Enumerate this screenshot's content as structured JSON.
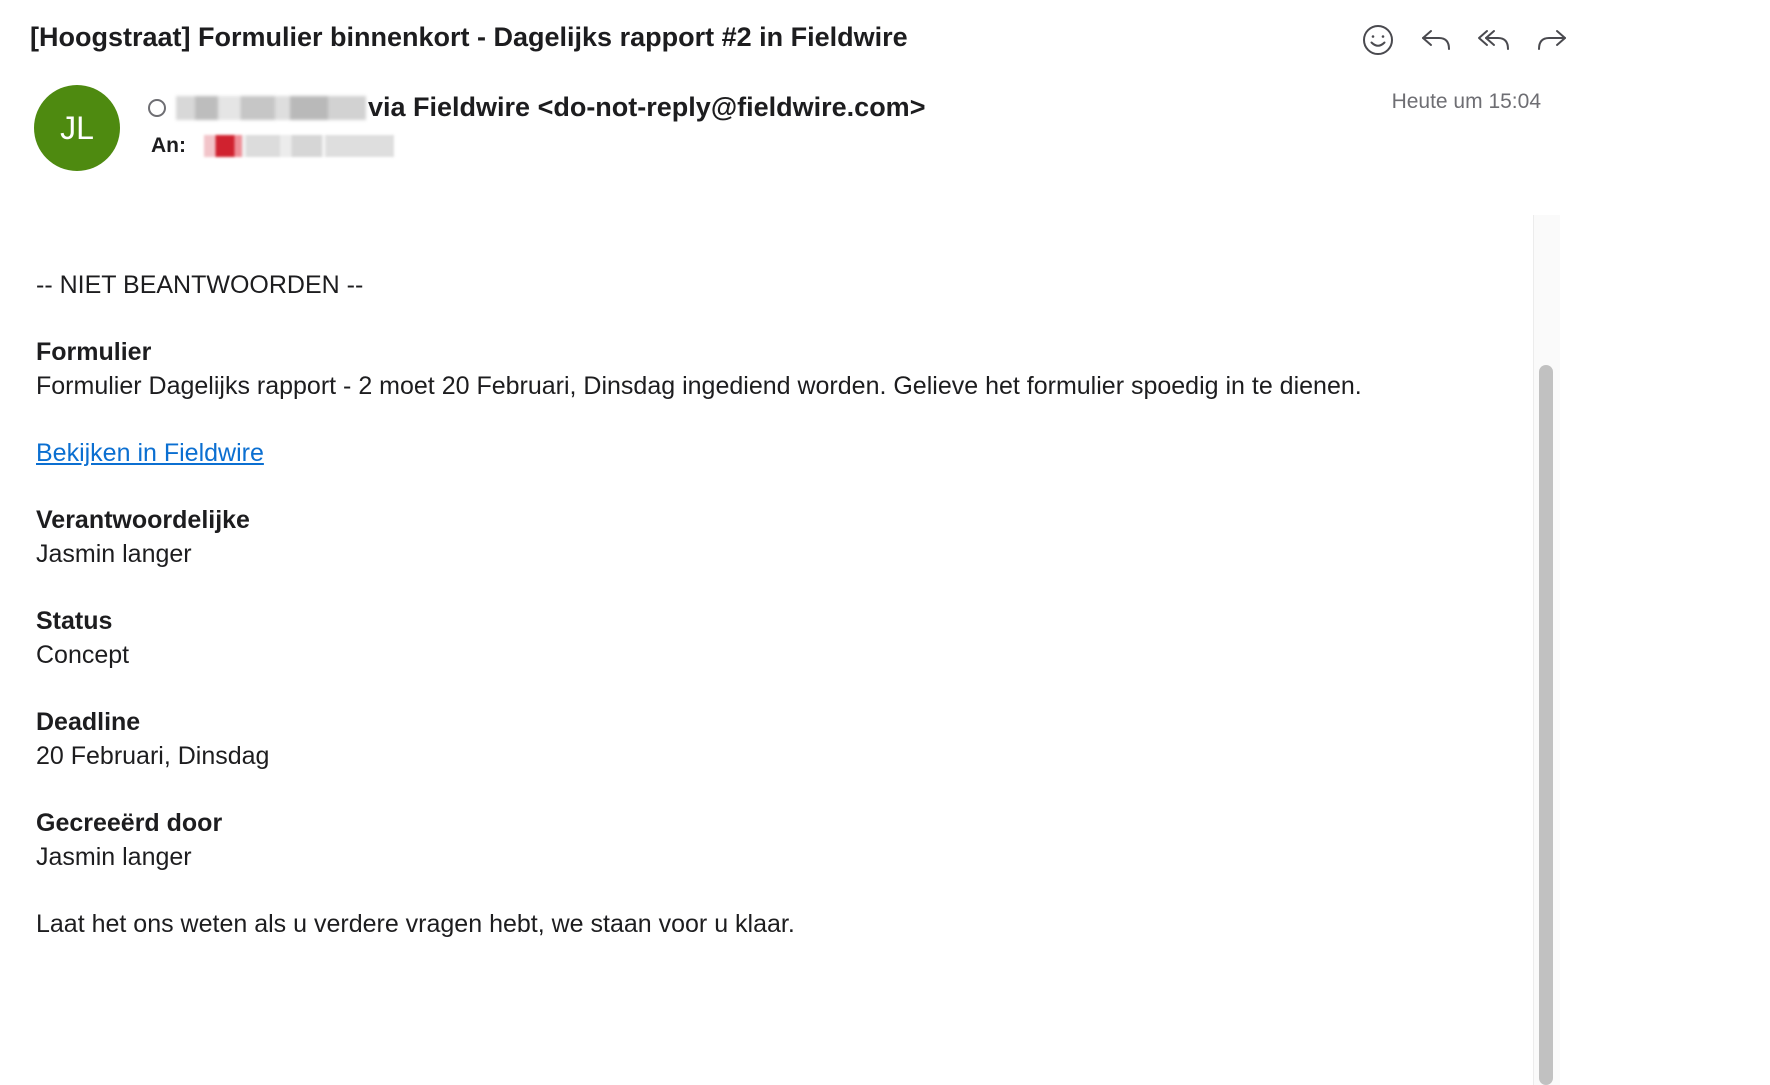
{
  "email": {
    "subject": "[Hoogstraat] Formulier binnenkort - Dagelijks rapport #2 in Fieldwire",
    "sender_initials": "JL",
    "sender_display": "via Fieldwire <do-not-reply@fieldwire.com>",
    "to_label": "An:",
    "date": "Heute um 15:04"
  },
  "actions": [
    {
      "icon": "smiley-icon"
    },
    {
      "icon": "reply-icon"
    },
    {
      "icon": "reply-all-icon"
    },
    {
      "icon": "forward-icon"
    }
  ],
  "body": {
    "notice": "-- NIET BEANTWOORDEN --",
    "form_label": "Formulier",
    "form_text": "Formulier Dagelijks rapport - 2 moet 20 Februari, Dinsdag ingediend worden. Gelieve het formulier spoedig in te dienen.",
    "link_text": "Bekijken in Fieldwire",
    "responsible_label": "Verantwoordelijke",
    "responsible_value": "Jasmin langer",
    "status_label": "Status",
    "status_value": "Concept",
    "deadline_label": "Deadline",
    "deadline_value": "20 Februari, Dinsdag",
    "created_label": "Gecreeërd door",
    "created_value": "Jasmin langer",
    "closing": "Laat het ons weten als u verdere vragen hebt, we staan voor u klaar."
  },
  "colors": {
    "avatar_bg": "#4e8a10",
    "link": "#0b6fd1",
    "redaction_red": "#d0222f"
  }
}
